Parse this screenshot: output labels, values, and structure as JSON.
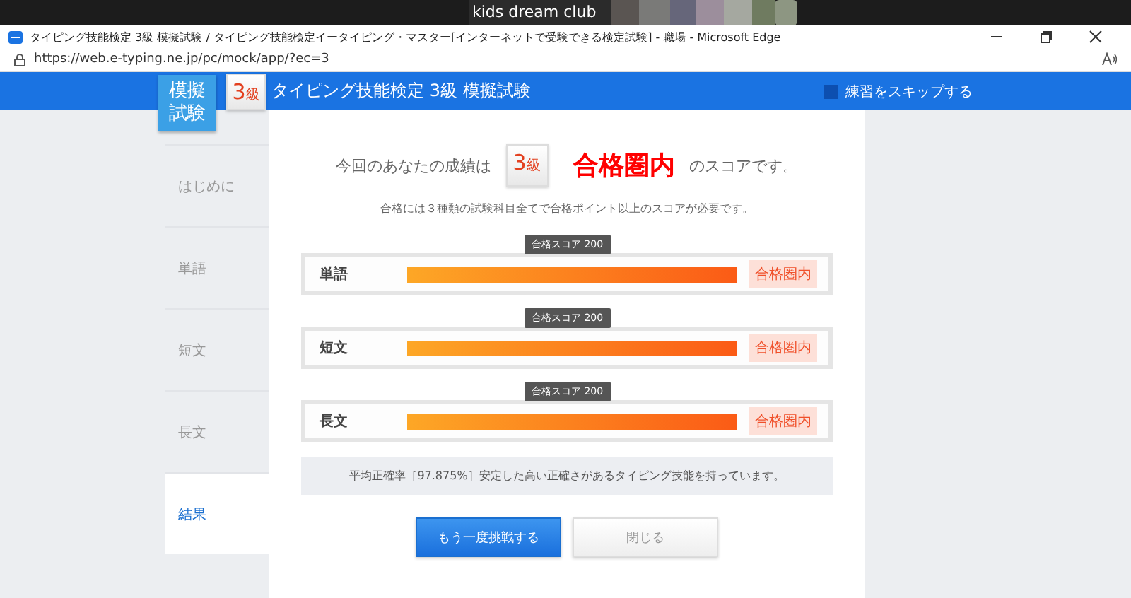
{
  "video_strip": {
    "kind": "picture",
    "caption": "kids dream club"
  },
  "window": {
    "title": "タイピング技能検定 3級 模擬試験 / タイピング技能検定イータイピング・マスター[インターネットで受験できる検定試験] - 職場 - Microsoft Edge",
    "url": "https://web.e-typing.ne.jp/pc/mock/app/?ec=3"
  },
  "header": {
    "logo_lines": [
      "模擬",
      "試験"
    ],
    "grade": {
      "number": "3",
      "unit": "級"
    },
    "title": "タイピング技能検定 3級 模擬試験",
    "skip": {
      "label": "練習をスキップする",
      "checked": false
    }
  },
  "sidebar": {
    "items": [
      {
        "label": "はじめに",
        "selected": false
      },
      {
        "label": "単語",
        "selected": false
      },
      {
        "label": "短文",
        "selected": false
      },
      {
        "label": "長文",
        "selected": false
      },
      {
        "label": "結果",
        "selected": true
      }
    ]
  },
  "result": {
    "prefix": "今回のあなたの成績は",
    "grade": {
      "number": "3",
      "unit": "級"
    },
    "verdict": "合格圏内",
    "suffix": "のスコアです。",
    "note": "合格には３種類の試験科目全てで合格ポイント以上のスコアが必要です。",
    "meters": [
      {
        "name": "単語",
        "threshold_label": "合格スコア 200",
        "level": 1,
        "status": "合格圏内"
      },
      {
        "name": "短文",
        "threshold_label": "合格スコア 200",
        "level": 1,
        "status": "合格圏内"
      },
      {
        "name": "長文",
        "threshold_label": "合格スコア 200",
        "level": 1,
        "status": "合格圏内"
      }
    ],
    "summary": "平均正確率［97.875%］安定した高い正確さがあるタイピング技能を持っています。",
    "buttons": [
      {
        "label": "もう一度挑戦する",
        "kind": "primary"
      },
      {
        "label": "閉じる",
        "kind": "secondary"
      }
    ]
  }
}
